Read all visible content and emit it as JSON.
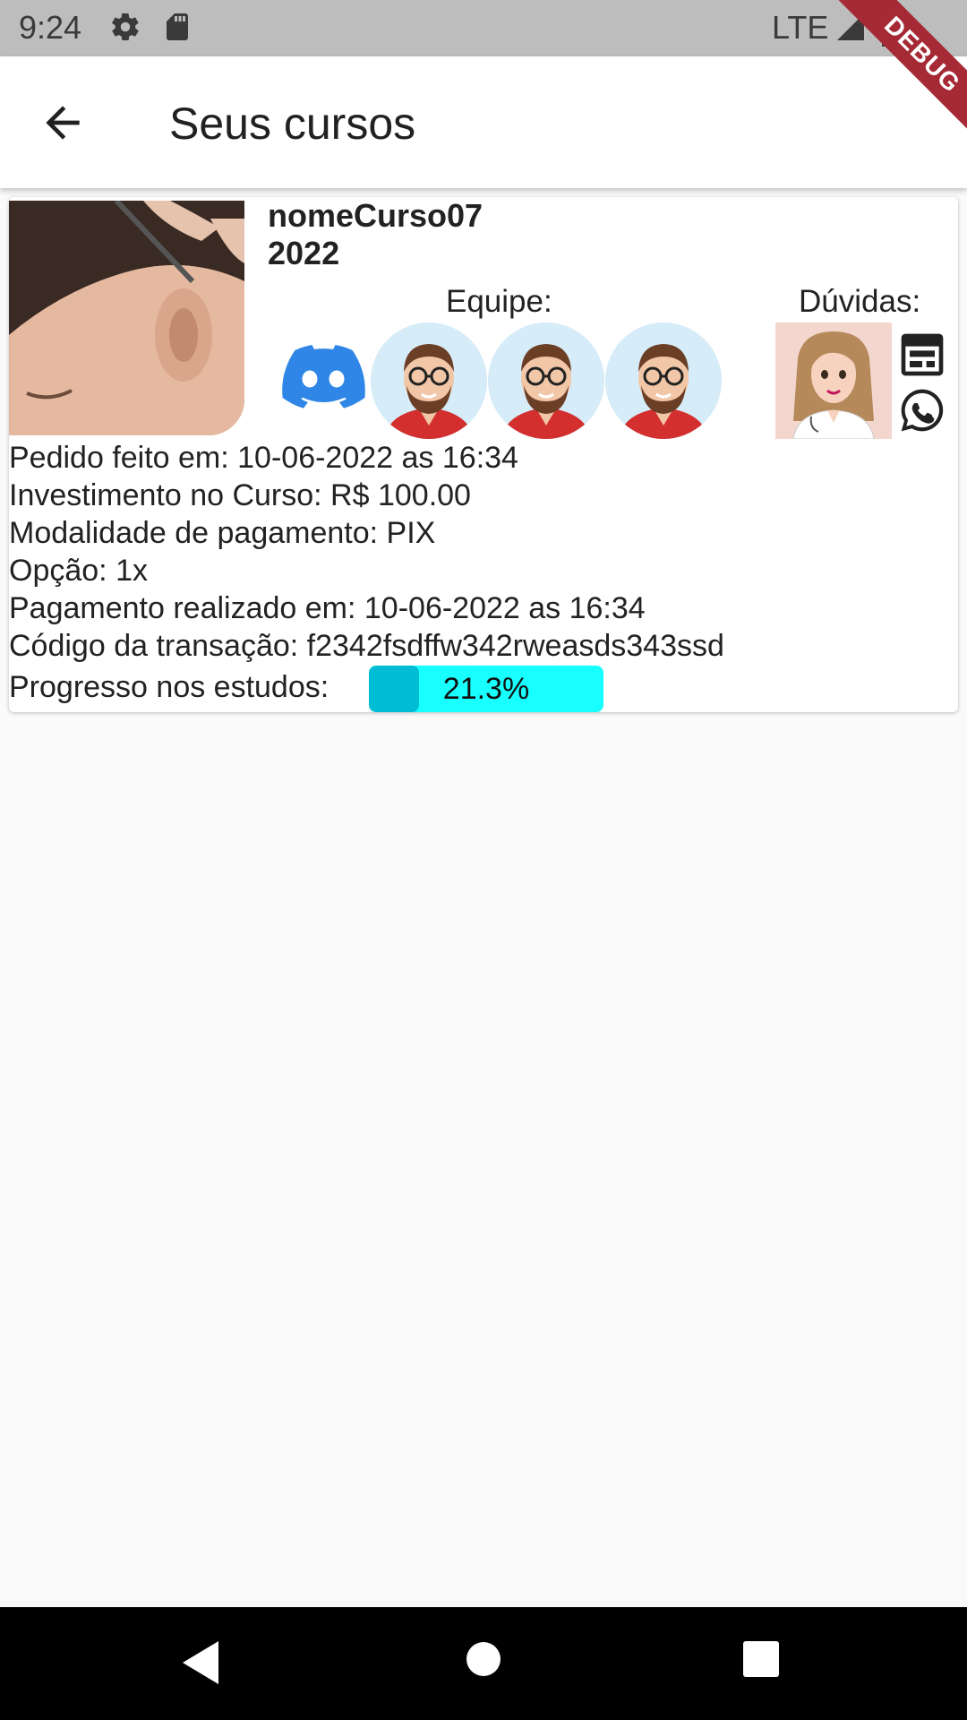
{
  "status_bar": {
    "time": "9:24",
    "network": "LTE"
  },
  "debug_banner": "DEBUG",
  "app_bar": {
    "title": "Seus cursos"
  },
  "course": {
    "name": "nomeCurso07",
    "year": "2022",
    "team_label": "Equipe:",
    "questions_label": "Dúvidas:",
    "order_date": "Pedido feito em: 10-06-2022 as 16:34",
    "investment": "Investimento no Curso: R$ 100.00",
    "payment_method": "Modalidade de pagamento: PIX",
    "option": "Opção: 1x",
    "payment_date": "Pagamento realizado em: 10-06-2022 as 16:34",
    "transaction_code": "Código da transação: f2342fsdffw342rweasds343ssd",
    "progress_label": "Progresso nos estudos:",
    "progress_value": 21.3,
    "progress_text": "21.3%"
  },
  "colors": {
    "progress_track": "#18ffff",
    "progress_fill": "#00bcd4",
    "discord": "#2f86e6",
    "debug": "#a52a35"
  },
  "icons": [
    "settings-icon",
    "sd-card-icon",
    "signal-icon",
    "battery-icon",
    "back-arrow-icon",
    "discord-icon",
    "web-icon",
    "whatsapp-icon",
    "nav-back-icon",
    "nav-home-icon",
    "nav-recents-icon"
  ]
}
